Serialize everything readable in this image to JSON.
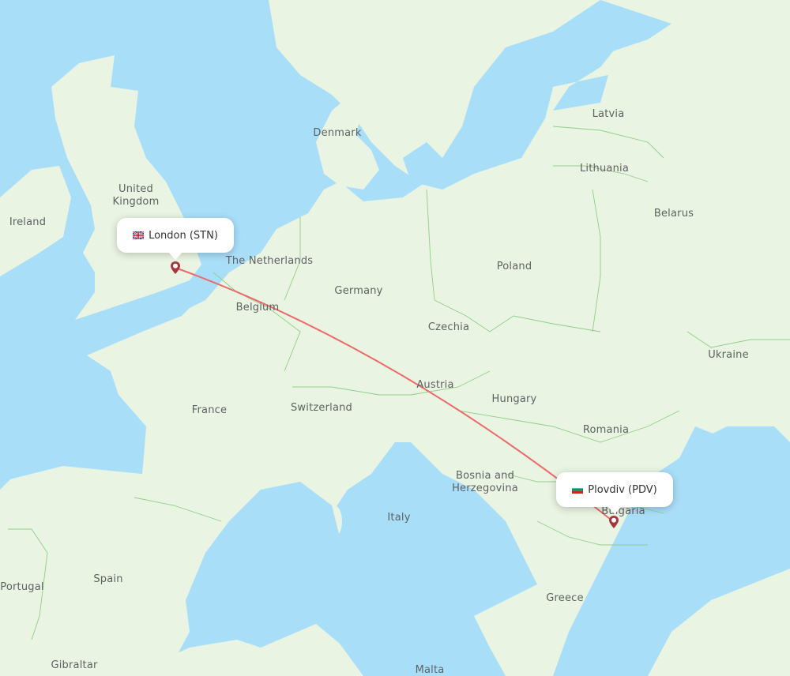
{
  "map": {
    "colors": {
      "water": "#a9def9",
      "land": "#e9f4e2",
      "land_dark": "#dcebd2",
      "border": "#8fcf8a",
      "route": "#ec6a6a",
      "marker": "#a5363b",
      "label": "#5f6163"
    },
    "origin": {
      "city": "London",
      "code": "STN",
      "label": "London (STN)",
      "flag_icon": "uk-flag-icon"
    },
    "destination": {
      "city": "Plovdiv",
      "code": "PDV",
      "label": "Plovdiv (PDV)",
      "flag_icon": "bulgaria-flag-icon"
    },
    "country_labels": [
      {
        "id": "ireland",
        "text": "Ireland"
      },
      {
        "id": "united-kingdom",
        "text": "United Kingdom"
      },
      {
        "id": "denmark",
        "text": "Denmark"
      },
      {
        "id": "the-netherlands",
        "text": "The Netherlands"
      },
      {
        "id": "belgium",
        "text": "Belgium"
      },
      {
        "id": "germany",
        "text": "Germany"
      },
      {
        "id": "france",
        "text": "France"
      },
      {
        "id": "switzerland",
        "text": "Switzerland"
      },
      {
        "id": "austria",
        "text": "Austria"
      },
      {
        "id": "czechia",
        "text": "Czechia"
      },
      {
        "id": "poland",
        "text": "Poland"
      },
      {
        "id": "latvia",
        "text": "Latvia"
      },
      {
        "id": "lithuania",
        "text": "Lithuania"
      },
      {
        "id": "belarus",
        "text": "Belarus"
      },
      {
        "id": "ukraine",
        "text": "Ukraine"
      },
      {
        "id": "hungary",
        "text": "Hungary"
      },
      {
        "id": "romania",
        "text": "Romania"
      },
      {
        "id": "bosnia",
        "text": "Bosnia and Herzegovina"
      },
      {
        "id": "bulgaria",
        "text": "Bulgaria"
      },
      {
        "id": "italy",
        "text": "Italy"
      },
      {
        "id": "greece",
        "text": "Greece"
      },
      {
        "id": "spain",
        "text": "Spain"
      },
      {
        "id": "portugal",
        "text": "Portugal"
      },
      {
        "id": "gibraltar",
        "text": "Gibraltar"
      },
      {
        "id": "malta",
        "text": "Malta"
      }
    ]
  }
}
